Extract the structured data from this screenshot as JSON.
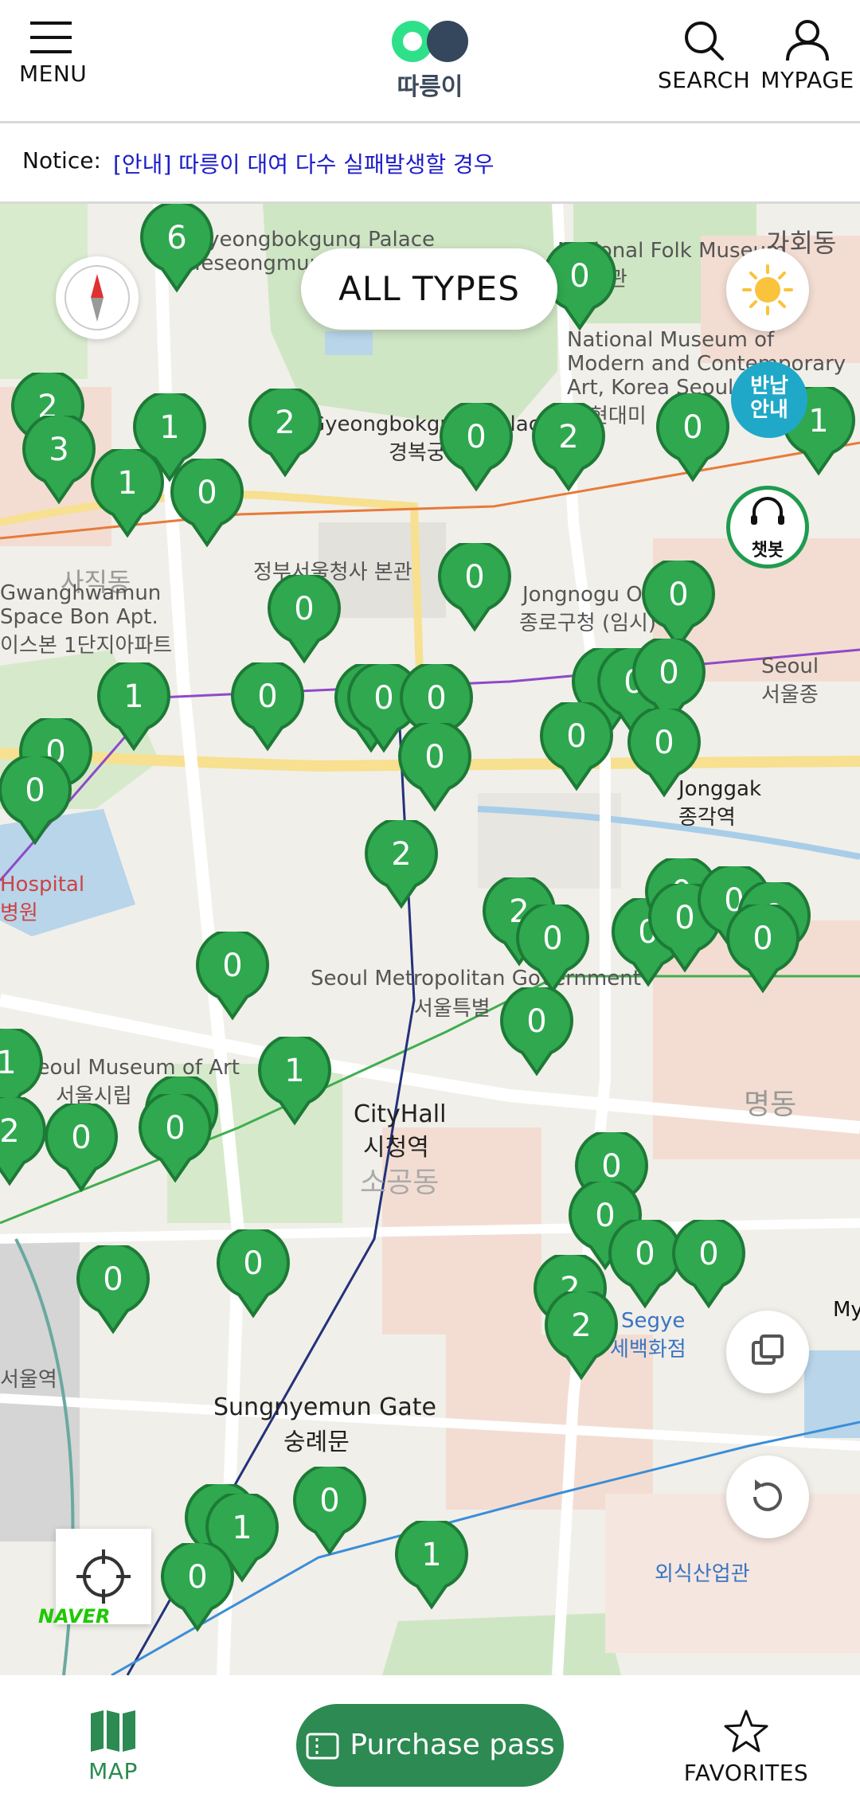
{
  "header": {
    "menu_label": "MENU",
    "logo_text": "따릉이",
    "search_label": "SEARCH",
    "mypage_label": "MYPAGE"
  },
  "notice": {
    "label": "Notice:",
    "text": "[안내] 따릉이 대여 다수 실패발생할 경우"
  },
  "map": {
    "type_filter_label": "ALL TYPES",
    "return_info_label": "반납\n안내",
    "chatbot_label": "챗봇",
    "provider": "NAVER",
    "place_labels": [
      "Gyeongbokgung Palace",
      "Yeseongmun",
      "National Folk Museum",
      "물관",
      "가회동",
      "National Museum of",
      "Modern and Contemporary",
      "Art, Korea Seoul",
      "현대미",
      "Gyeongbokgung Palace",
      "경복궁",
      "정부서울청사 본관",
      "Jongnogu Office",
      "종로구청 (임시)",
      "사직동",
      "Gwanghwamun",
      "Space Bon Apt.",
      "이스본 1단지아파트",
      "Seoul",
      "서울종",
      "Jonggak",
      "종각역",
      "Hospital",
      "병원",
      "Seoul Metropolitan Government",
      "서울특별",
      "Seoul Museum of Art",
      "서울시립",
      "CityHall",
      "시청역",
      "소공동",
      "명동",
      "Sungnyemun Gate",
      "숭례문",
      "서울역",
      "Segye",
      "세백화점",
      "외식산업관",
      "My"
    ],
    "station_markers": [
      "6",
      "0",
      "2",
      "3",
      "1",
      "2",
      "1",
      "0",
      "0",
      "2",
      "0",
      "1",
      "0",
      "0",
      "0",
      "1",
      "0",
      "0",
      "0",
      "0",
      "0",
      "0",
      "0",
      "0",
      "0",
      "0",
      "0",
      "0",
      "2",
      "2",
      "0",
      "0",
      "0",
      "0",
      "0",
      "0",
      "0",
      "0",
      "0",
      "1",
      "0",
      "1",
      "2",
      "0",
      "0",
      "0",
      "0",
      "0",
      "0",
      "2",
      "0",
      "0",
      "2",
      "0",
      "1",
      "0",
      "0",
      "1"
    ],
    "colors": {
      "marker_fill": "#2fa84f",
      "marker_stroke": "#1d7a36",
      "primary_green": "#2c8a52",
      "notice_text": "#1c1cc8",
      "return_info_bg": "#1fa8c8"
    }
  },
  "bottom_nav": {
    "map_label": "MAP",
    "purchase_label": "Purchase pass",
    "favorites_label": "FAVORITES"
  }
}
